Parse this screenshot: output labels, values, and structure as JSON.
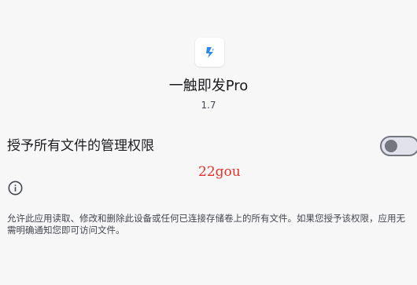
{
  "app": {
    "icon": "blue-lightning-app-icon",
    "name": "一触即发Pro",
    "version": "1.7"
  },
  "permission": {
    "label": "授予所有文件的管理权限",
    "enabled": false
  },
  "watermark": "22gou",
  "info": {
    "icon": "info-icon",
    "text": "允许此应用读取、修改和删除此设备或任何已连接存储卷上的所有文件。如果您授予该权限，应用无需明确通知您即可访问文件。"
  },
  "colors": {
    "background": "#f7f7f7",
    "primary_text": "#1b1b1f",
    "secondary_text": "#44474f",
    "toggle_outline": "#74777f",
    "watermark": "#e3322b",
    "app_icon_accent": "#2f8ae6"
  }
}
